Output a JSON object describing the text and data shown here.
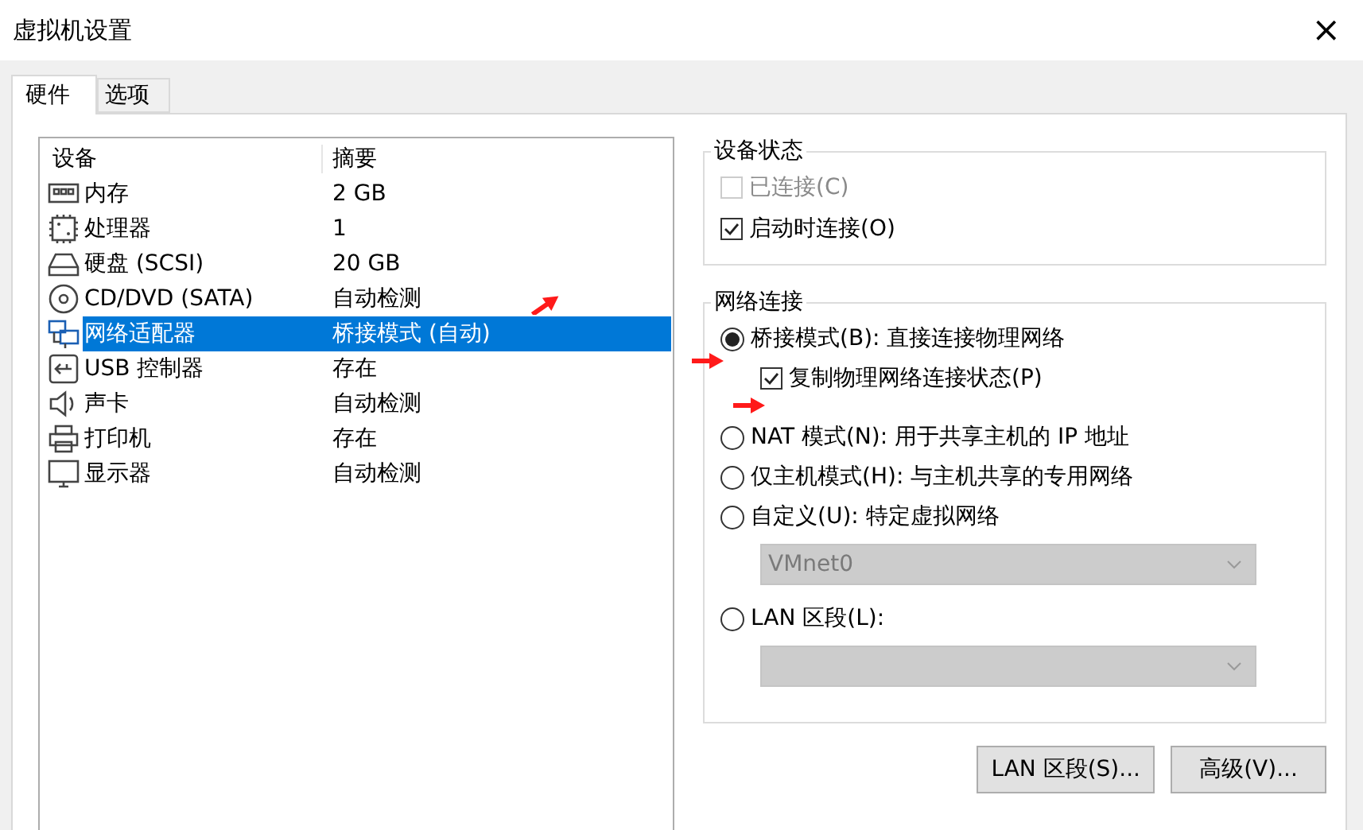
{
  "window": {
    "title": "虚拟机设置",
    "close": "×"
  },
  "tabs": [
    {
      "label": "硬件",
      "selected": true
    },
    {
      "label": "选项",
      "selected": false
    }
  ],
  "devices": {
    "columns": [
      "设备",
      "摘要"
    ],
    "rows": [
      {
        "device": "内存",
        "summary": "2 GB",
        "selected": false
      },
      {
        "device": "处理器",
        "summary": "1",
        "selected": false
      },
      {
        "device": "硬盘 (SCSI)",
        "summary": "20 GB",
        "selected": false
      },
      {
        "device": "CD/DVD (SATA)",
        "summary": "自动检测",
        "selected": false
      },
      {
        "device": "网络适配器",
        "summary": "桥接模式 (自动)",
        "selected": true
      },
      {
        "device": "USB 控制器",
        "summary": "存在",
        "selected": false
      },
      {
        "device": "声卡",
        "summary": "自动检测",
        "selected": false
      },
      {
        "device": "打印机",
        "summary": "存在",
        "selected": false
      },
      {
        "device": "显示器",
        "summary": "自动检测",
        "selected": false
      }
    ]
  },
  "device_status": {
    "title": "设备状态",
    "items": [
      {
        "label": "已连接(C)",
        "checked": false,
        "disabled": true
      },
      {
        "label": "启动时连接(O)",
        "checked": true,
        "disabled": false
      }
    ]
  },
  "network": {
    "title": "网络连接",
    "items": [
      {
        "kind": "radio",
        "label": "桥接模式(B): 直接连接物理网络",
        "selected": true
      },
      {
        "kind": "checkbox",
        "label": "复制物理网络连接状态(P)",
        "checked": true
      },
      {
        "kind": "radio",
        "label": "NAT 模式(N): 用于共享主机的 IP 地址",
        "selected": false
      },
      {
        "kind": "radio",
        "label": "仅主机模式(H): 与主机共享的专用网络",
        "selected": false
      },
      {
        "kind": "radio",
        "label": "自定义(U): 特定虚拟网络",
        "selected": false
      },
      {
        "kind": "dropdown",
        "value": "VMnet0",
        "disabled": true
      },
      {
        "kind": "radio",
        "label": "LAN 区段(L):",
        "selected": false
      },
      {
        "kind": "dropdown",
        "disabled": true
      }
    ]
  },
  "buttons": [
    "LAN 区段(S)...",
    "高级(V)..."
  ]
}
